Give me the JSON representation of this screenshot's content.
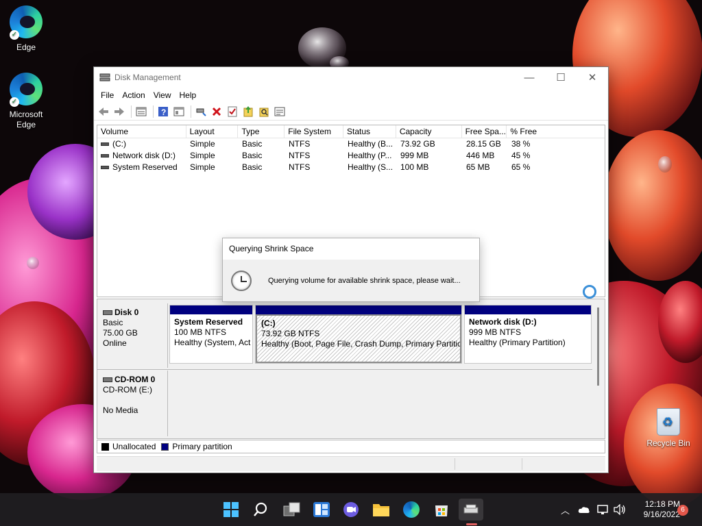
{
  "desktop": {
    "icons": [
      {
        "label": "Edge"
      },
      {
        "label": "Microsoft Edge"
      }
    ],
    "recycle_bin": "Recycle Bin"
  },
  "window": {
    "title": "Disk Management",
    "menu": [
      "File",
      "Action",
      "View",
      "Help"
    ],
    "toolbar_icons": [
      "back-arrow-icon",
      "forward-arrow-icon",
      "list-view-icon",
      "help-icon",
      "properties-icon",
      "connect-icon",
      "delete-icon",
      "check-icon",
      "export-icon",
      "search-icon",
      "settings-list-icon"
    ],
    "columns": [
      "Volume",
      "Layout",
      "Type",
      "File System",
      "Status",
      "Capacity",
      "Free Spa...",
      "% Free"
    ],
    "volumes": [
      {
        "volume": "(C:)",
        "layout": "Simple",
        "type": "Basic",
        "fs": "NTFS",
        "status": "Healthy (B...",
        "capacity": "73.92 GB",
        "free": "28.15 GB",
        "pct": "38 %"
      },
      {
        "volume": "Network disk (D:)",
        "layout": "Simple",
        "type": "Basic",
        "fs": "NTFS",
        "status": "Healthy (P...",
        "capacity": "999 MB",
        "free": "446 MB",
        "pct": "45 %"
      },
      {
        "volume": "System Reserved",
        "layout": "Simple",
        "type": "Basic",
        "fs": "NTFS",
        "status": "Healthy (S...",
        "capacity": "100 MB",
        "free": "65 MB",
        "pct": "65 %"
      }
    ],
    "disk0": {
      "name": "Disk 0",
      "type": "Basic",
      "size": "75.00 GB",
      "state": "Online",
      "partitions": [
        {
          "name": "System Reserved",
          "size": "100 MB NTFS",
          "status": "Healthy (System, Act"
        },
        {
          "name": "(C:)",
          "size": "73.92 GB NTFS",
          "status": "Healthy (Boot, Page File, Crash Dump, Primary Partition"
        },
        {
          "name": "Network disk  (D:)",
          "size": "999 MB NTFS",
          "status": "Healthy (Primary Partition)"
        }
      ]
    },
    "cdrom0": {
      "name": "CD-ROM 0",
      "drive": "CD-ROM (E:)",
      "media": "No Media"
    },
    "legend": [
      {
        "label": "Unallocated",
        "color": "#000000"
      },
      {
        "label": "Primary partition",
        "color": "#000080"
      }
    ]
  },
  "dialog": {
    "title": "Querying Shrink Space",
    "message": "Querying volume for available shrink space, please wait..."
  },
  "taskbar": {
    "apps": [
      "start-icon",
      "search-icon",
      "task-view-icon",
      "widgets-icon",
      "chat-icon",
      "file-explorer-icon",
      "edge-icon",
      "store-icon",
      "disk-management-icon"
    ],
    "time": "12:18 PM",
    "date": "9/16/2022",
    "notifications": "6"
  }
}
